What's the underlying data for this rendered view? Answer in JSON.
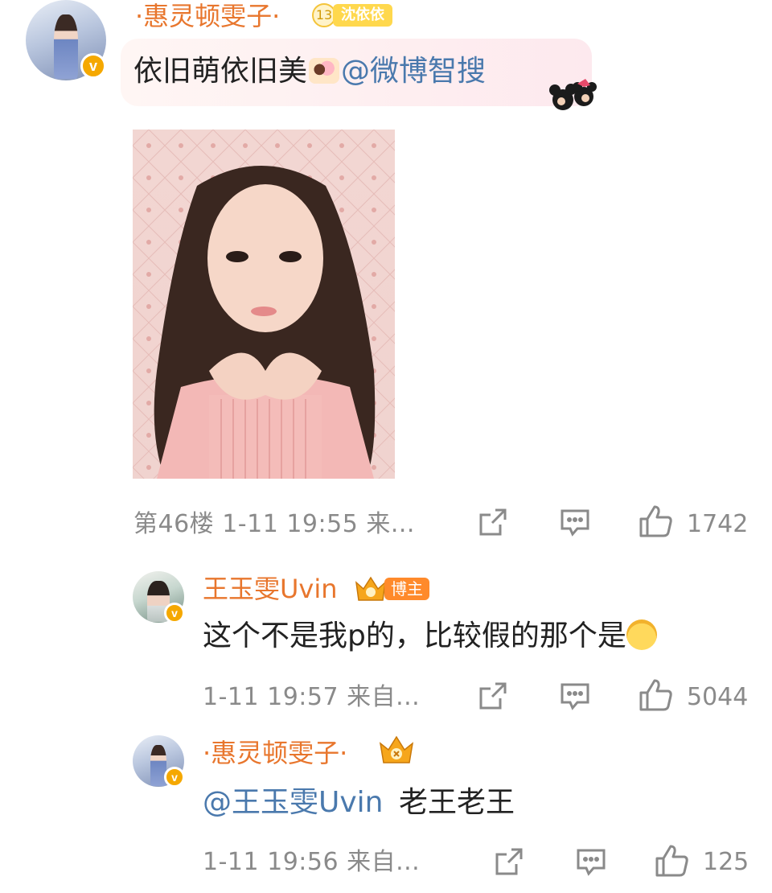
{
  "post": {
    "author_name": "·惠灵顿雯子·",
    "fan_badge_level": "13",
    "fan_badge_label": "沈依依",
    "text": "依旧萌依旧美",
    "mention": "@微博智搜",
    "meta": "第46楼 1-11 19:55 来...",
    "likes": "1742"
  },
  "reply1": {
    "author_name": "王玉雯Uvin",
    "host_badge": "博主",
    "text": "这个不是我p的，比较假的那个是",
    "meta": "1-11 19:57 来自...",
    "likes": "5044"
  },
  "reply2": {
    "author_name": "·惠灵顿雯子·",
    "mention": "@王玉雯Uvin",
    "text": "老王老王",
    "meta": "1-11 19:56 来自...",
    "likes": "125"
  },
  "colors": {
    "name_orange": "#e8762d",
    "link_blue": "#4a79ad",
    "meta_gray": "#8a8a8a",
    "verified_gold": "#f5a800"
  },
  "icons": [
    "share-icon",
    "comment-icon",
    "like-icon",
    "verified-icon",
    "crown-icon"
  ]
}
